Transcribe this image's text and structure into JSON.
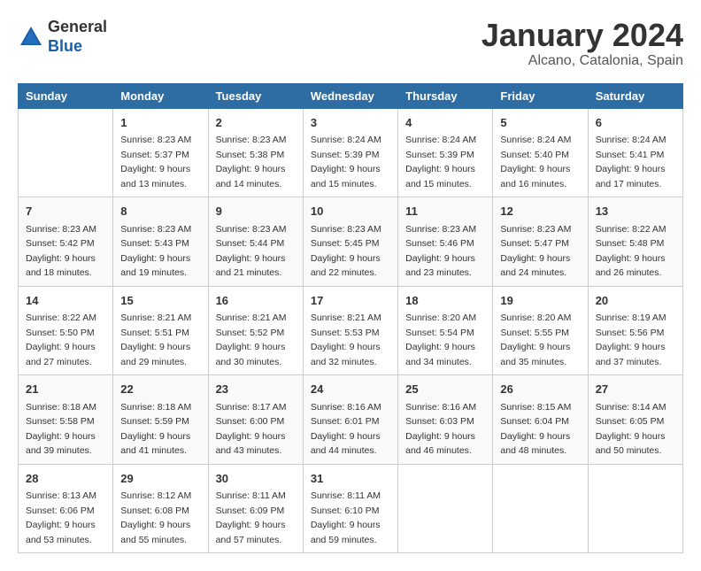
{
  "header": {
    "logo": {
      "general": "General",
      "blue": "Blue"
    },
    "title": "January 2024",
    "subtitle": "Alcano, Catalonia, Spain"
  },
  "weekdays": [
    "Sunday",
    "Monday",
    "Tuesday",
    "Wednesday",
    "Thursday",
    "Friday",
    "Saturday"
  ],
  "weeks": [
    [
      {
        "day": "",
        "sunrise": "",
        "sunset": "",
        "daylight": ""
      },
      {
        "day": "1",
        "sunrise": "Sunrise: 8:23 AM",
        "sunset": "Sunset: 5:37 PM",
        "daylight": "Daylight: 9 hours and 13 minutes."
      },
      {
        "day": "2",
        "sunrise": "Sunrise: 8:23 AM",
        "sunset": "Sunset: 5:38 PM",
        "daylight": "Daylight: 9 hours and 14 minutes."
      },
      {
        "day": "3",
        "sunrise": "Sunrise: 8:24 AM",
        "sunset": "Sunset: 5:39 PM",
        "daylight": "Daylight: 9 hours and 15 minutes."
      },
      {
        "day": "4",
        "sunrise": "Sunrise: 8:24 AM",
        "sunset": "Sunset: 5:39 PM",
        "daylight": "Daylight: 9 hours and 15 minutes."
      },
      {
        "day": "5",
        "sunrise": "Sunrise: 8:24 AM",
        "sunset": "Sunset: 5:40 PM",
        "daylight": "Daylight: 9 hours and 16 minutes."
      },
      {
        "day": "6",
        "sunrise": "Sunrise: 8:24 AM",
        "sunset": "Sunset: 5:41 PM",
        "daylight": "Daylight: 9 hours and 17 minutes."
      }
    ],
    [
      {
        "day": "7",
        "sunrise": "Sunrise: 8:23 AM",
        "sunset": "Sunset: 5:42 PM",
        "daylight": "Daylight: 9 hours and 18 minutes."
      },
      {
        "day": "8",
        "sunrise": "Sunrise: 8:23 AM",
        "sunset": "Sunset: 5:43 PM",
        "daylight": "Daylight: 9 hours and 19 minutes."
      },
      {
        "day": "9",
        "sunrise": "Sunrise: 8:23 AM",
        "sunset": "Sunset: 5:44 PM",
        "daylight": "Daylight: 9 hours and 21 minutes."
      },
      {
        "day": "10",
        "sunrise": "Sunrise: 8:23 AM",
        "sunset": "Sunset: 5:45 PM",
        "daylight": "Daylight: 9 hours and 22 minutes."
      },
      {
        "day": "11",
        "sunrise": "Sunrise: 8:23 AM",
        "sunset": "Sunset: 5:46 PM",
        "daylight": "Daylight: 9 hours and 23 minutes."
      },
      {
        "day": "12",
        "sunrise": "Sunrise: 8:23 AM",
        "sunset": "Sunset: 5:47 PM",
        "daylight": "Daylight: 9 hours and 24 minutes."
      },
      {
        "day": "13",
        "sunrise": "Sunrise: 8:22 AM",
        "sunset": "Sunset: 5:48 PM",
        "daylight": "Daylight: 9 hours and 26 minutes."
      }
    ],
    [
      {
        "day": "14",
        "sunrise": "Sunrise: 8:22 AM",
        "sunset": "Sunset: 5:50 PM",
        "daylight": "Daylight: 9 hours and 27 minutes."
      },
      {
        "day": "15",
        "sunrise": "Sunrise: 8:21 AM",
        "sunset": "Sunset: 5:51 PM",
        "daylight": "Daylight: 9 hours and 29 minutes."
      },
      {
        "day": "16",
        "sunrise": "Sunrise: 8:21 AM",
        "sunset": "Sunset: 5:52 PM",
        "daylight": "Daylight: 9 hours and 30 minutes."
      },
      {
        "day": "17",
        "sunrise": "Sunrise: 8:21 AM",
        "sunset": "Sunset: 5:53 PM",
        "daylight": "Daylight: 9 hours and 32 minutes."
      },
      {
        "day": "18",
        "sunrise": "Sunrise: 8:20 AM",
        "sunset": "Sunset: 5:54 PM",
        "daylight": "Daylight: 9 hours and 34 minutes."
      },
      {
        "day": "19",
        "sunrise": "Sunrise: 8:20 AM",
        "sunset": "Sunset: 5:55 PM",
        "daylight": "Daylight: 9 hours and 35 minutes."
      },
      {
        "day": "20",
        "sunrise": "Sunrise: 8:19 AM",
        "sunset": "Sunset: 5:56 PM",
        "daylight": "Daylight: 9 hours and 37 minutes."
      }
    ],
    [
      {
        "day": "21",
        "sunrise": "Sunrise: 8:18 AM",
        "sunset": "Sunset: 5:58 PM",
        "daylight": "Daylight: 9 hours and 39 minutes."
      },
      {
        "day": "22",
        "sunrise": "Sunrise: 8:18 AM",
        "sunset": "Sunset: 5:59 PM",
        "daylight": "Daylight: 9 hours and 41 minutes."
      },
      {
        "day": "23",
        "sunrise": "Sunrise: 8:17 AM",
        "sunset": "Sunset: 6:00 PM",
        "daylight": "Daylight: 9 hours and 43 minutes."
      },
      {
        "day": "24",
        "sunrise": "Sunrise: 8:16 AM",
        "sunset": "Sunset: 6:01 PM",
        "daylight": "Daylight: 9 hours and 44 minutes."
      },
      {
        "day": "25",
        "sunrise": "Sunrise: 8:16 AM",
        "sunset": "Sunset: 6:03 PM",
        "daylight": "Daylight: 9 hours and 46 minutes."
      },
      {
        "day": "26",
        "sunrise": "Sunrise: 8:15 AM",
        "sunset": "Sunset: 6:04 PM",
        "daylight": "Daylight: 9 hours and 48 minutes."
      },
      {
        "day": "27",
        "sunrise": "Sunrise: 8:14 AM",
        "sunset": "Sunset: 6:05 PM",
        "daylight": "Daylight: 9 hours and 50 minutes."
      }
    ],
    [
      {
        "day": "28",
        "sunrise": "Sunrise: 8:13 AM",
        "sunset": "Sunset: 6:06 PM",
        "daylight": "Daylight: 9 hours and 53 minutes."
      },
      {
        "day": "29",
        "sunrise": "Sunrise: 8:12 AM",
        "sunset": "Sunset: 6:08 PM",
        "daylight": "Daylight: 9 hours and 55 minutes."
      },
      {
        "day": "30",
        "sunrise": "Sunrise: 8:11 AM",
        "sunset": "Sunset: 6:09 PM",
        "daylight": "Daylight: 9 hours and 57 minutes."
      },
      {
        "day": "31",
        "sunrise": "Sunrise: 8:11 AM",
        "sunset": "Sunset: 6:10 PM",
        "daylight": "Daylight: 9 hours and 59 minutes."
      },
      {
        "day": "",
        "sunrise": "",
        "sunset": "",
        "daylight": ""
      },
      {
        "day": "",
        "sunrise": "",
        "sunset": "",
        "daylight": ""
      },
      {
        "day": "",
        "sunrise": "",
        "sunset": "",
        "daylight": ""
      }
    ]
  ]
}
